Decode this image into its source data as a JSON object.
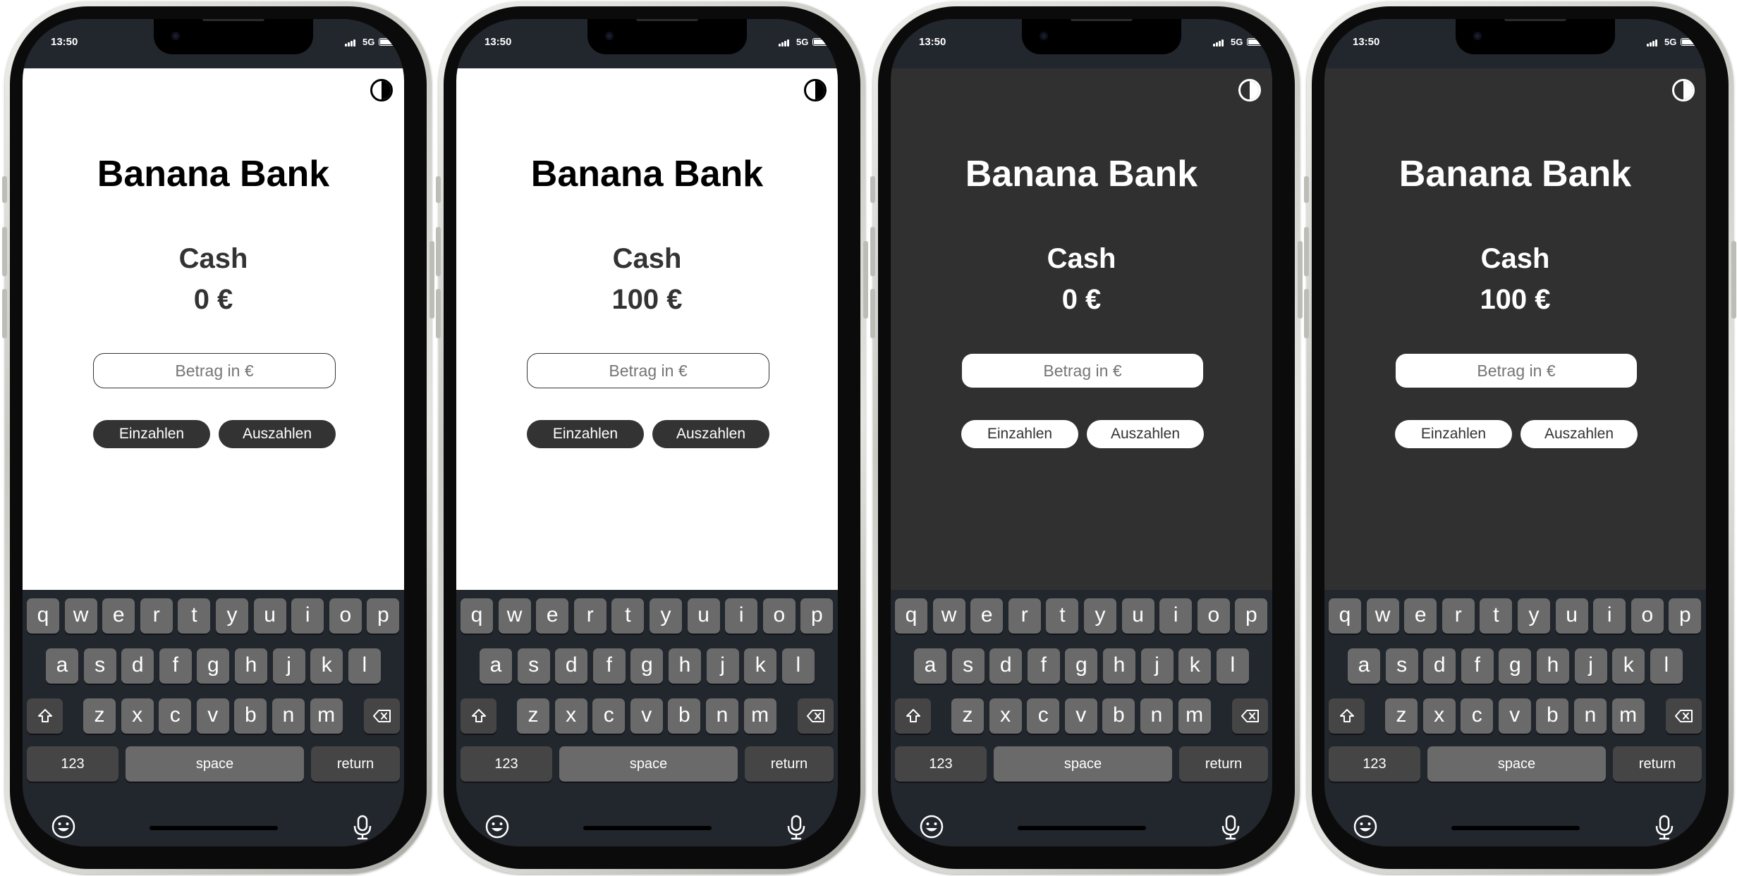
{
  "phones": [
    {
      "theme": "light",
      "status": {
        "time": "13:50",
        "network": "5G"
      },
      "app": {
        "title": "Banana Bank",
        "cash_label": "Cash",
        "cash_amount": "0 €",
        "amount_placeholder": "Betrag in €",
        "deposit_label": "Einzahlen",
        "withdraw_label": "Auszahlen"
      }
    },
    {
      "theme": "light",
      "status": {
        "time": "13:50",
        "network": "5G"
      },
      "app": {
        "title": "Banana Bank",
        "cash_label": "Cash",
        "cash_amount": "100 €",
        "amount_placeholder": "Betrag in €",
        "deposit_label": "Einzahlen",
        "withdraw_label": "Auszahlen"
      }
    },
    {
      "theme": "dark",
      "status": {
        "time": "13:50",
        "network": "5G"
      },
      "app": {
        "title": "Banana Bank",
        "cash_label": "Cash",
        "cash_amount": "0 €",
        "amount_placeholder": "Betrag in €",
        "deposit_label": "Einzahlen",
        "withdraw_label": "Auszahlen"
      }
    },
    {
      "theme": "dark",
      "status": {
        "time": "13:50",
        "network": "5G"
      },
      "app": {
        "title": "Banana Bank",
        "cash_label": "Cash",
        "cash_amount": "100 €",
        "amount_placeholder": "Betrag in €",
        "deposit_label": "Einzahlen",
        "withdraw_label": "Auszahlen"
      }
    }
  ],
  "keyboard": {
    "row1": [
      "q",
      "w",
      "e",
      "r",
      "t",
      "y",
      "u",
      "i",
      "o",
      "p"
    ],
    "row2": [
      "a",
      "s",
      "d",
      "f",
      "g",
      "h",
      "j",
      "k",
      "l"
    ],
    "row3": [
      "z",
      "x",
      "c",
      "v",
      "b",
      "n",
      "m"
    ],
    "numbers_label": "123",
    "space_label": "space",
    "return_label": "return",
    "icons": {
      "shift": "shift-icon",
      "delete": "backspace-icon",
      "emoji": "emoji-icon",
      "mic": "microphone-icon",
      "theme": "contrast-icon"
    }
  },
  "colors": {
    "light_background": "#ffffff",
    "dark_background": "#303030",
    "text_dark": "#333333",
    "keyboard_background": "#22262d",
    "key": "#6a6a6a",
    "function_key": "#454545"
  }
}
